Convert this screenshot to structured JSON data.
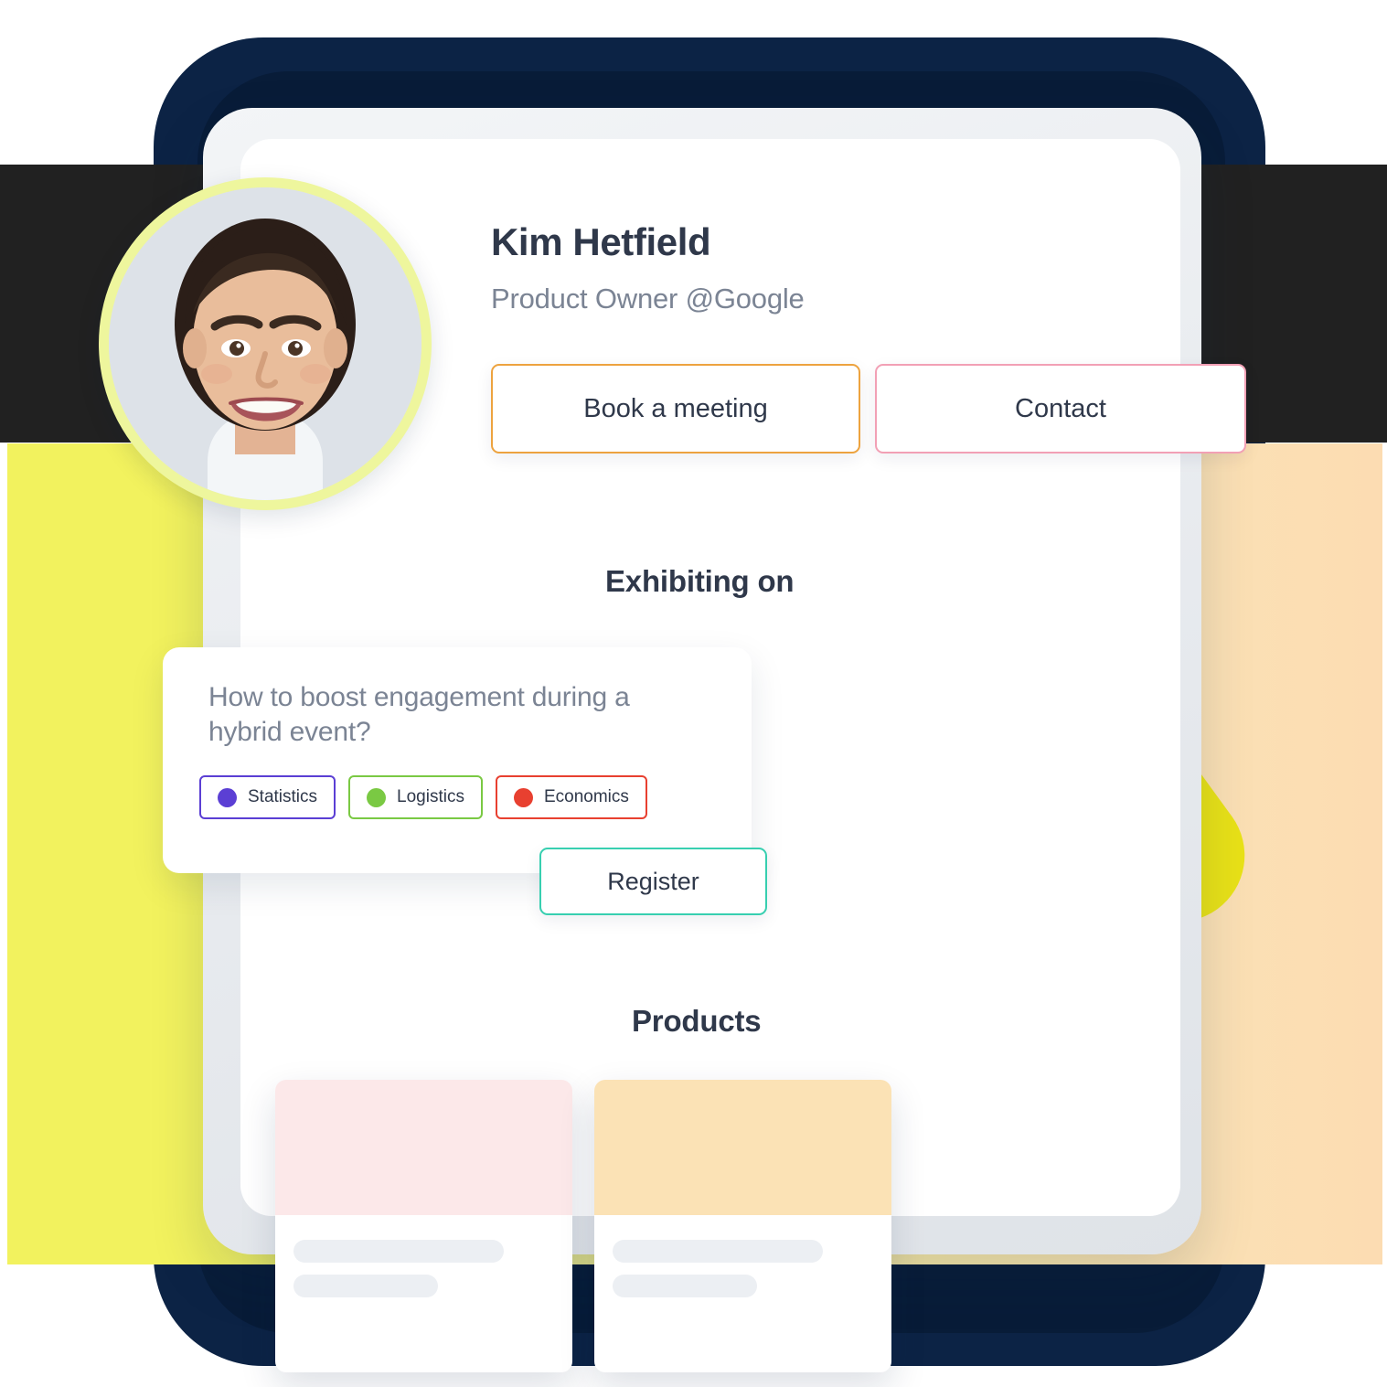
{
  "profile": {
    "name": "Kim Hetfield",
    "role": "Product Owner @Google",
    "avatar_icon": "avatar-photo"
  },
  "actions": {
    "book_label": "Book a meeting",
    "book_border_color": "#eda33f",
    "contact_label": "Contact",
    "contact_border_color": "#f2a0b5"
  },
  "sections": {
    "exhibiting_heading": "Exhibiting on",
    "products_heading": "Products"
  },
  "session": {
    "question": "How to boost engagement during a hybrid event?",
    "register_label": "Register",
    "register_border_color": "#37cfb0",
    "tags": [
      {
        "label": "Statistics",
        "dot_color": "#5b3fd4",
        "border_color": "#5b3fd4"
      },
      {
        "label": "Logistics",
        "dot_color": "#7ac943",
        "border_color": "#7ac943"
      },
      {
        "label": "Economics",
        "dot_color": "#e84030",
        "border_color": "#e84030"
      }
    ]
  },
  "products": [
    {
      "media_color": "#fce8e9"
    },
    {
      "media_color": "#fbe2b5"
    }
  ],
  "theme": {
    "navy": "#0c2345",
    "navy_shade": "#081c38",
    "dark_band": "#212121",
    "yellow_band_start": "#f2f25e",
    "yellow_band_end": "#fcdcb2",
    "yellow_pill": "#e9e217",
    "avatar_ring": "#eef69d",
    "heading_color": "#2f384a",
    "muted_text": "#7b8494"
  }
}
